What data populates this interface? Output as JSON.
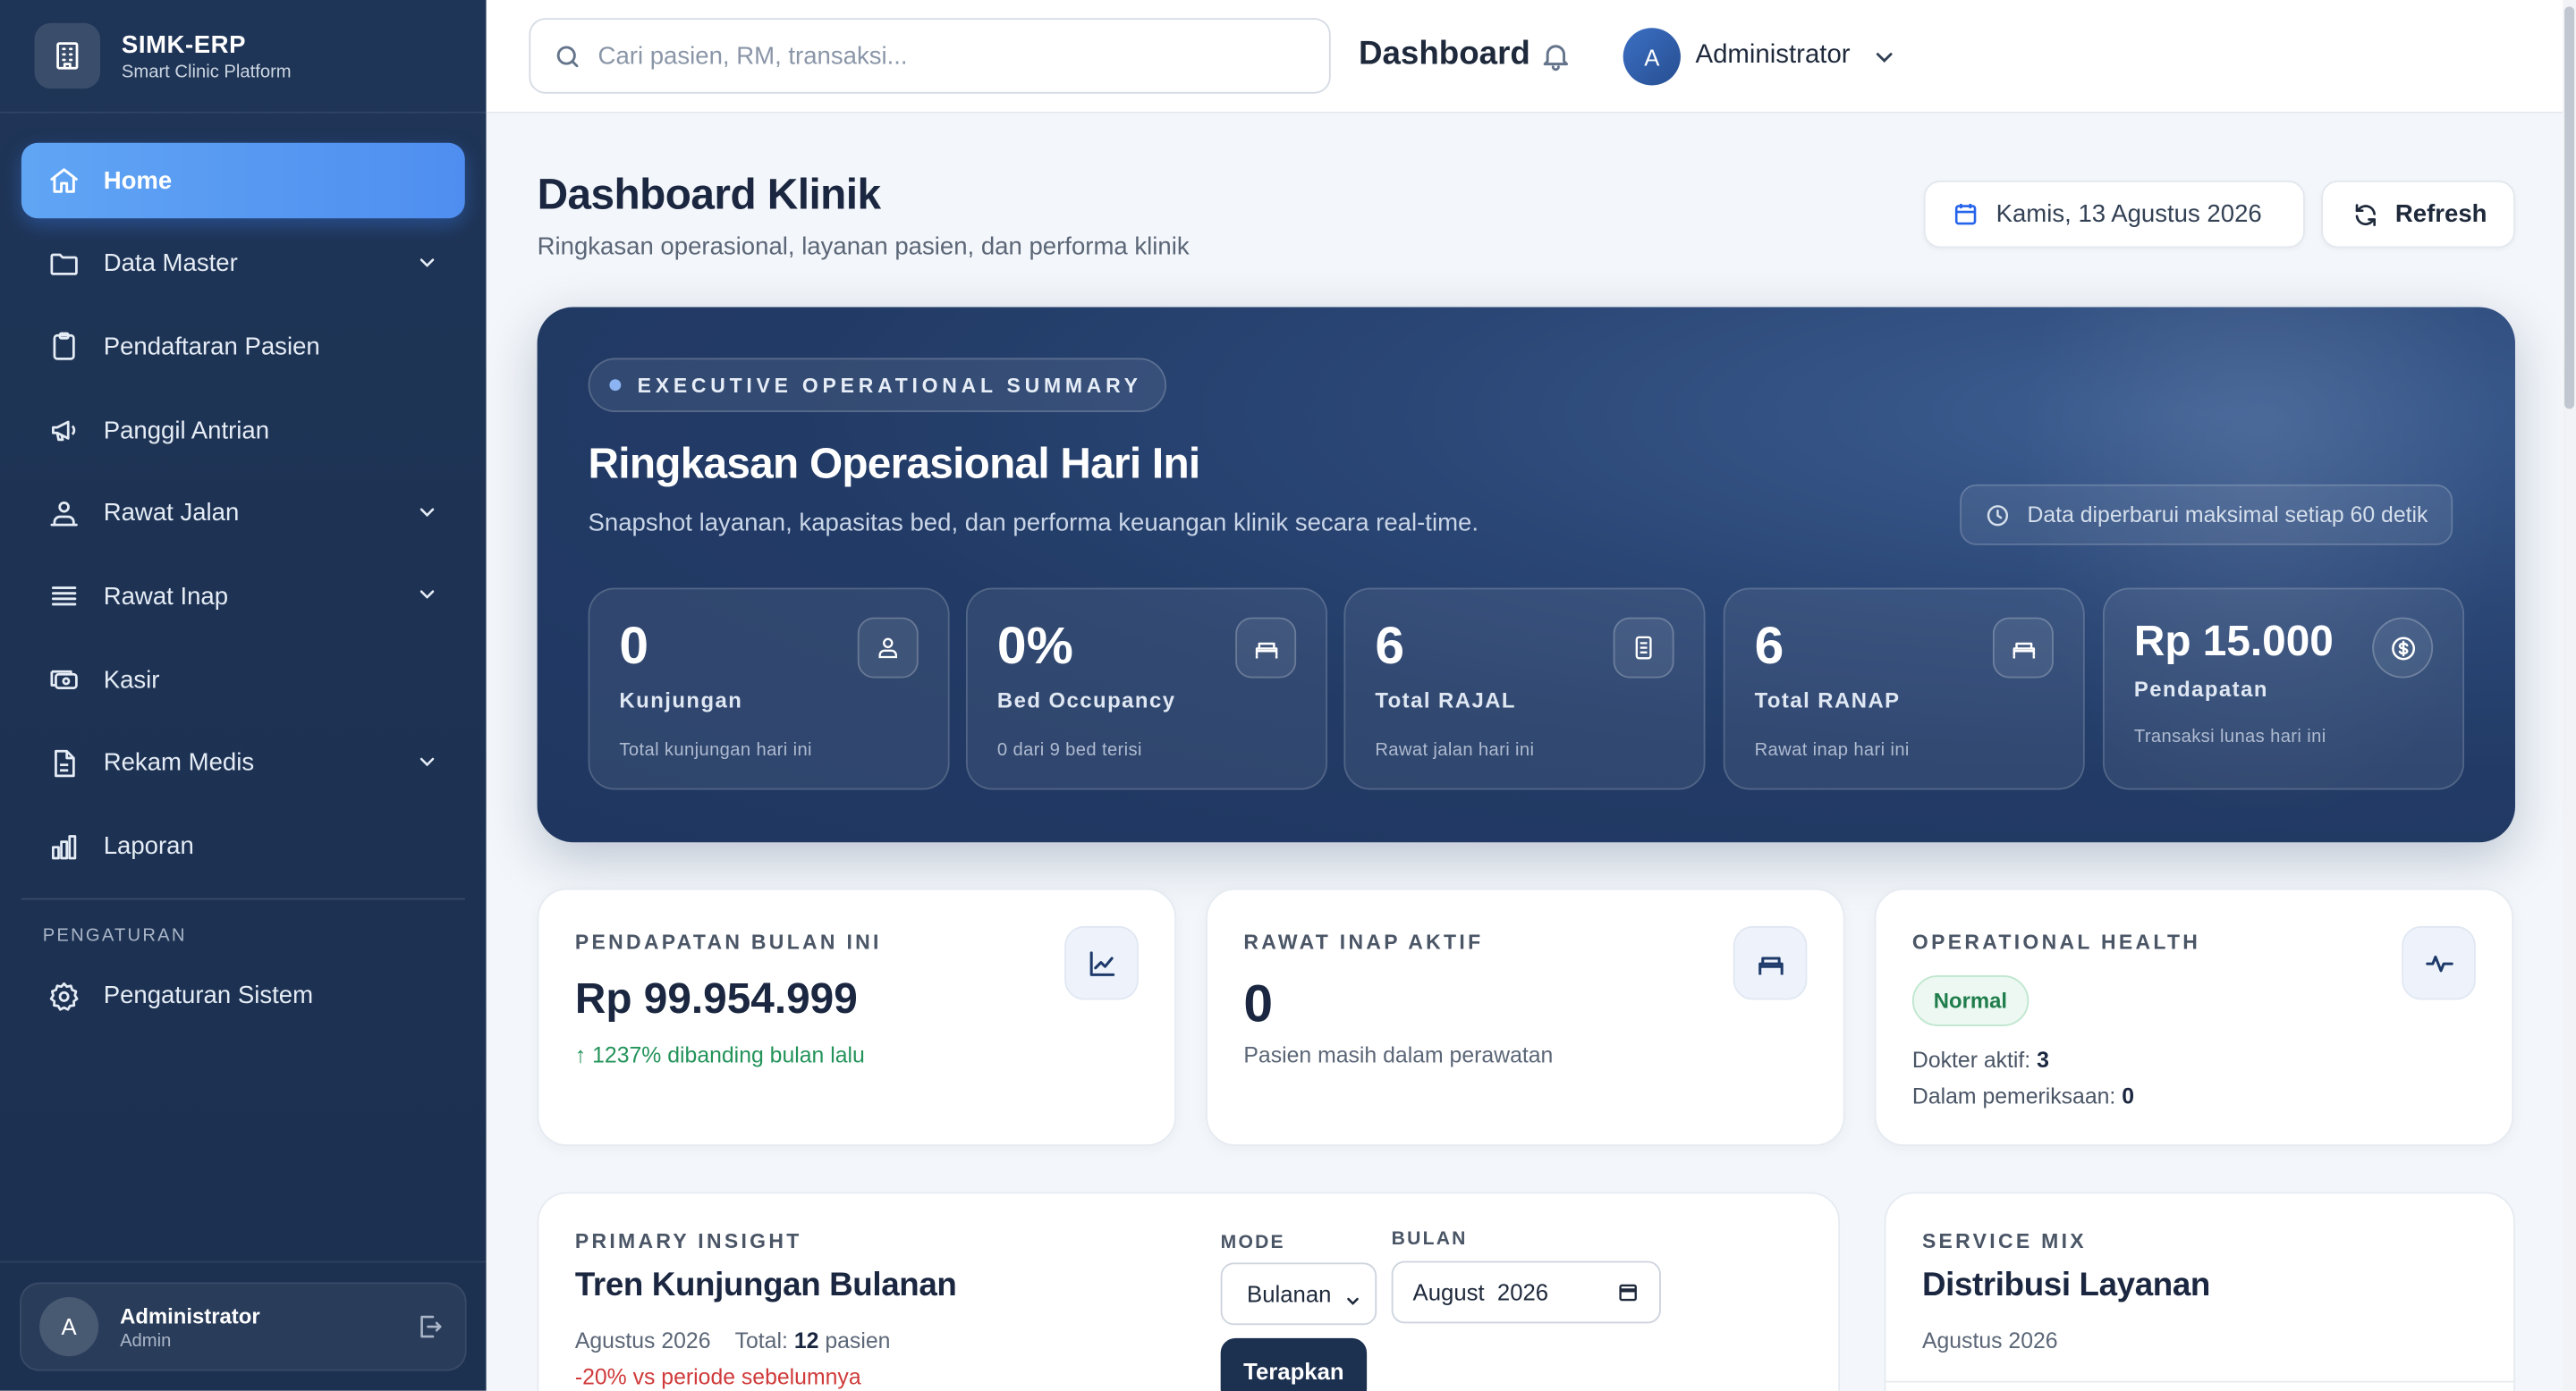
{
  "brand": {
    "title": "SIMK-ERP",
    "subtitle": "Smart Clinic Platform"
  },
  "sidebar": {
    "items": [
      {
        "label": "Home",
        "icon": "home-icon",
        "active": true
      },
      {
        "label": "Data Master",
        "icon": "folder-icon",
        "expandable": true
      },
      {
        "label": "Pendaftaran Pasien",
        "icon": "clipboard-icon"
      },
      {
        "label": "Panggil Antrian",
        "icon": "megaphone-icon"
      },
      {
        "label": "Rawat Jalan",
        "icon": "user-walk-icon",
        "expandable": true
      },
      {
        "label": "Rawat Inap",
        "icon": "list-icon",
        "expandable": true
      },
      {
        "label": "Kasir",
        "icon": "cash-icon"
      },
      {
        "label": "Rekam Medis",
        "icon": "document-icon",
        "expandable": true
      },
      {
        "label": "Laporan",
        "icon": "bar-chart-icon"
      }
    ],
    "section_label": "PENGATURAN",
    "settings_item": {
      "label": "Pengaturan Sistem",
      "icon": "gear-icon"
    },
    "user": {
      "initial": "A",
      "name": "Administrator",
      "role": "Admin"
    }
  },
  "topbar": {
    "search_placeholder": "Cari pasien, RM, transaksi...",
    "title": "Dashboard",
    "user_initial": "A",
    "user_name": "Administrator"
  },
  "page": {
    "title": "Dashboard Klinik",
    "subtitle": "Ringkasan operasional, layanan pasien, dan performa klinik",
    "date": "Kamis, 13 Agustus 2026",
    "refresh_label": "Refresh"
  },
  "hero": {
    "pill": "EXECUTIVE OPERATIONAL SUMMARY",
    "title": "Ringkasan Operasional Hari Ini",
    "subtitle": "Snapshot layanan, kapasitas bed, dan performa keuangan klinik secara real-time.",
    "note": "Data diperbarui maksimal setiap 60 detik",
    "kpis": [
      {
        "value": "0",
        "label": "Kunjungan",
        "foot": "Total kunjungan hari ini",
        "icon": "user-icon"
      },
      {
        "value": "0%",
        "label": "Bed Occupancy",
        "foot": "0 dari 9 bed terisi",
        "icon": "bed-icon"
      },
      {
        "value": "6",
        "label": "Total RAJAL",
        "foot": "Rawat jalan hari ini",
        "icon": "document-icon"
      },
      {
        "value": "6",
        "label": "Total RANAP",
        "foot": "Rawat inap hari ini",
        "icon": "bed-icon"
      },
      {
        "value": "Rp 15.000",
        "label": "Pendapatan",
        "foot": "Transaksi lunas hari ini",
        "icon": "dollar-icon"
      }
    ]
  },
  "metrics": {
    "revenue": {
      "label": "PENDAPATAN BULAN INI",
      "value": "Rp 99.954.999",
      "change": "↑ 1237% dibanding bulan lalu"
    },
    "inpatient": {
      "label": "RAWAT INAP AKTIF",
      "value": "0",
      "sub": "Pasien masih dalam perawatan"
    },
    "health": {
      "label": "OPERATIONAL HEALTH",
      "status": "Normal",
      "doctors_label": "Dokter aktif:",
      "doctors_value": "3",
      "exam_label": "Dalam pemeriksaan:",
      "exam_value": "0"
    }
  },
  "insight": {
    "label": "PRIMARY INSIGHT",
    "title": "Tren Kunjungan Bulanan",
    "period": "Agustus 2026",
    "total_label": "Total:",
    "total_value": "12",
    "total_unit": "pasien",
    "change": "-20% vs periode sebelumnya",
    "mode_label": "MODE",
    "mode_value": "Bulanan",
    "month_label": "BULAN",
    "month_value": "August  2026",
    "apply_label": "Terapkan"
  },
  "service_mix": {
    "label": "SERVICE MIX",
    "title": "Distribusi Layanan",
    "period": "Agustus 2026"
  }
}
